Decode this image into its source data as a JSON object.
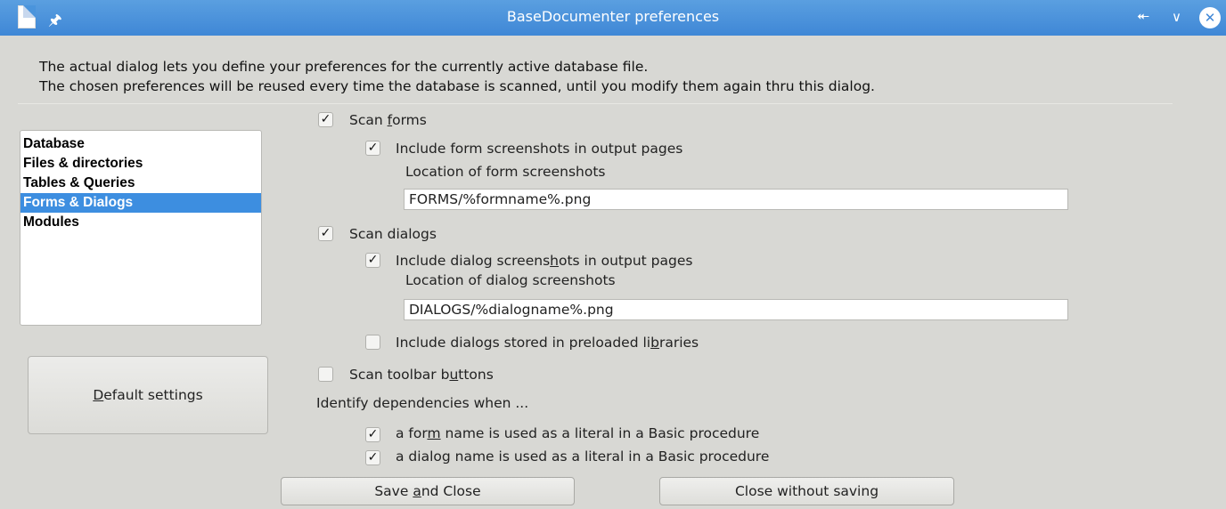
{
  "window": {
    "title": "BaseDocumenter preferences"
  },
  "intro": {
    "line1": "The actual dialog lets you define your preferences for the currently active database file.",
    "line2": "The chosen preferences will be reused every time the database is scanned, until you modify them again thru this dialog."
  },
  "sections": [
    {
      "label": "Database",
      "selected": false
    },
    {
      "label": "Files & directories",
      "selected": false
    },
    {
      "label": "Tables & Queries",
      "selected": false
    },
    {
      "label": "Forms & Dialogs",
      "selected": true
    },
    {
      "label": "Modules",
      "selected": false
    }
  ],
  "default_settings": {
    "pre": "",
    "ul": "D",
    "post": "efault settings"
  },
  "options": {
    "scan_forms": {
      "pre": "Scan ",
      "ul": "f",
      "post": "orms",
      "checked": true
    },
    "include_form_screenshots": {
      "pre": "Include form screenshots in output pa",
      "ul": "g",
      "post": "es",
      "checked": true
    },
    "form_location_label": "Location of form screenshots",
    "form_location_value": "FORMS/%formname%.png",
    "scan_dialogs": {
      "text": "Scan dialogs",
      "checked": true
    },
    "include_dialog_screenshots": {
      "pre": "Include dialog screens",
      "ul": "h",
      "post": "ots in output pages",
      "checked": true
    },
    "dialog_location_label": "Location of dialog screenshots",
    "dialog_location_value": "DIALOGS/%dialogname%.png",
    "include_preloaded": {
      "pre": "Include dialogs stored in preloaded li",
      "ul": "b",
      "post": "raries",
      "checked": false
    },
    "scan_toolbar": {
      "pre": "Scan toolbar b",
      "ul": "u",
      "post": "ttons",
      "checked": false
    },
    "dependencies_label": "Identify dependencies when ...",
    "dep_form": {
      "pre": "a for",
      "ul": "m",
      "post": " name is used as a literal in a Basic procedure",
      "checked": true
    },
    "dep_dialog": {
      "text": "a dialog name is used as a literal in a Basic procedure",
      "checked": true
    }
  },
  "buttons": {
    "save": {
      "pre": "Save ",
      "ul": "a",
      "post": "nd Close"
    },
    "close": {
      "text": "Close without saving"
    }
  },
  "icons": {
    "app": "document-icon",
    "pin": "pin-icon",
    "maximize": "chevron-double-up-icon",
    "minimize": "chevron-down-icon",
    "close": "close-icon"
  },
  "colors": {
    "titlebar": "#3f87d6",
    "selection": "#3d8ee0",
    "background": "#d8d8d4"
  }
}
